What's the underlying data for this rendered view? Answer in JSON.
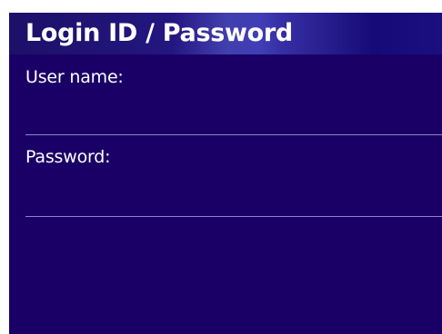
{
  "dialog": {
    "title": "Login ID / Password"
  },
  "form": {
    "username_label": "User name:",
    "username_value": "",
    "password_label": "Password:",
    "password_value": ""
  },
  "colors": {
    "background": "#1a0066",
    "text": "#ffffff",
    "divider": "#8c86c8"
  }
}
